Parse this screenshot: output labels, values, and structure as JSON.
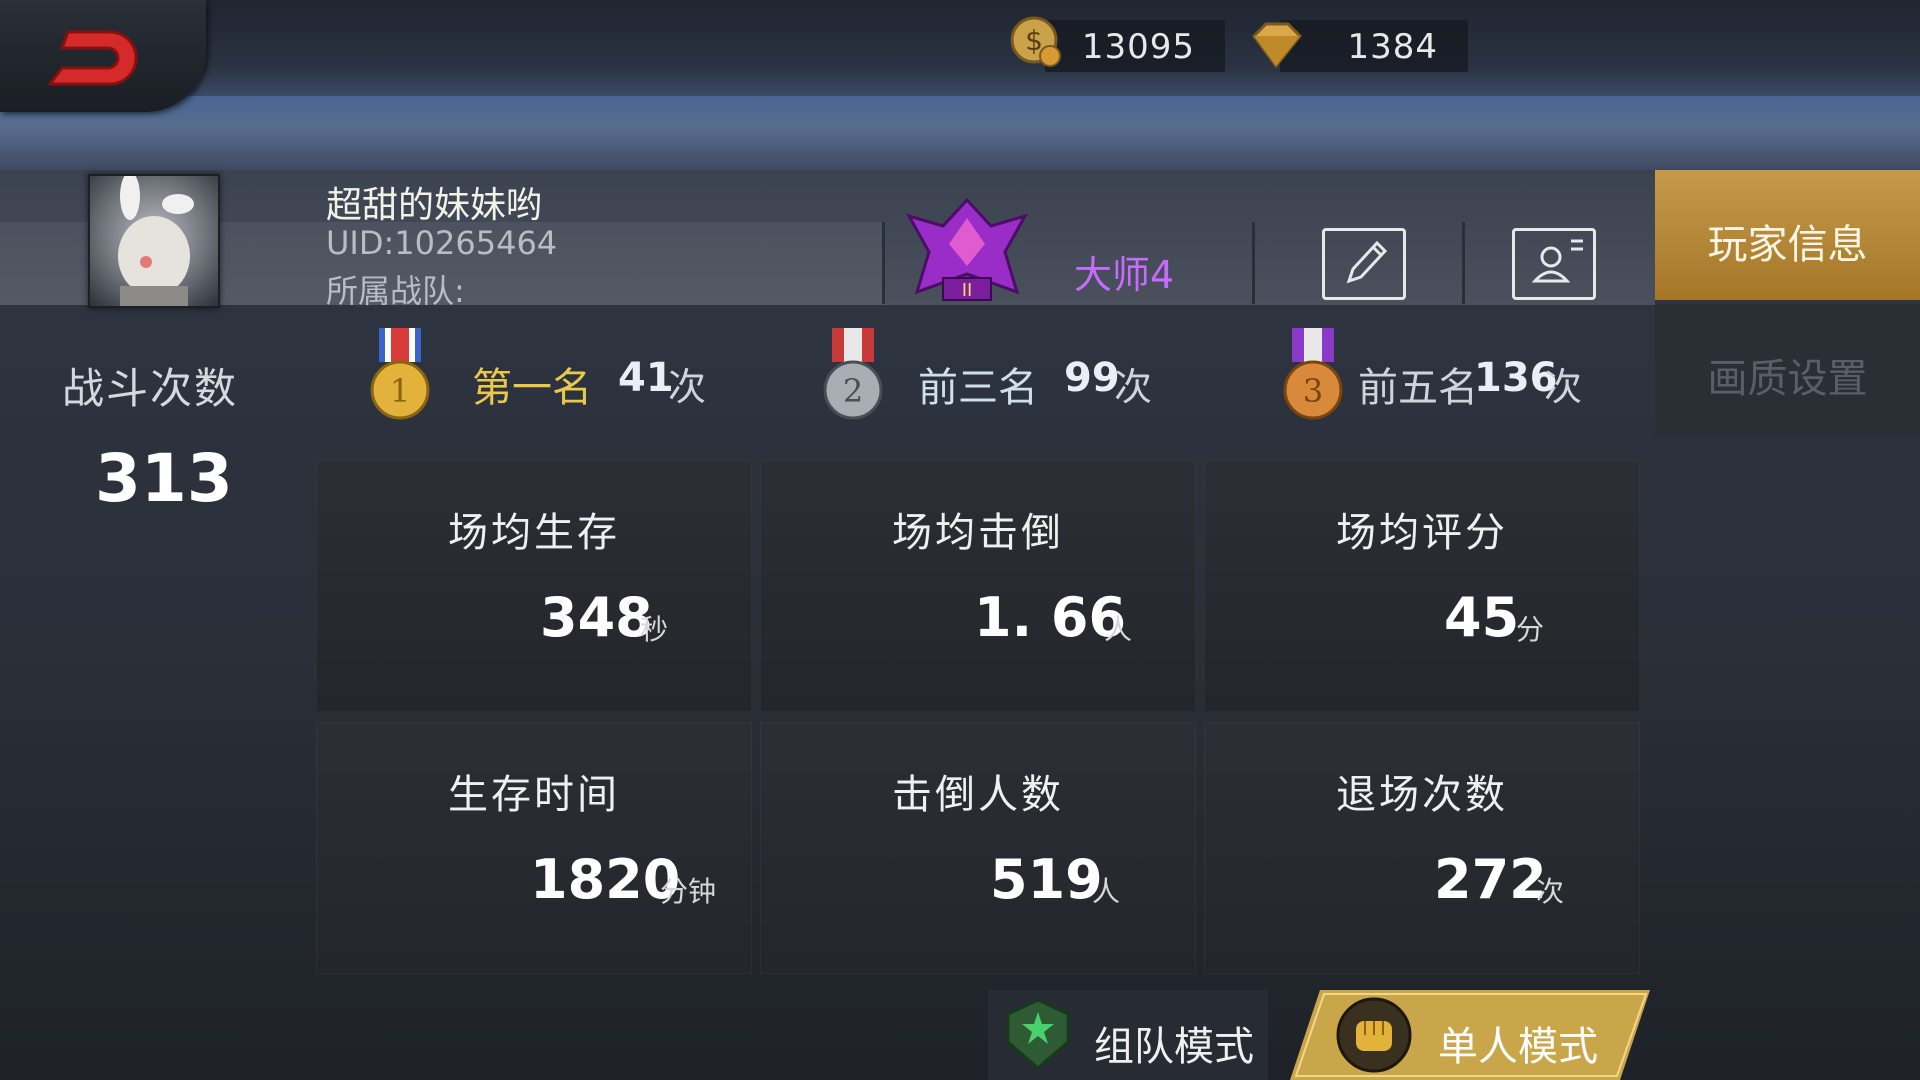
{
  "currency": {
    "coins": "13095",
    "gems": "1384"
  },
  "player": {
    "name": "超甜的妹妹哟",
    "uid": "UID:10265464",
    "team_label": "所属战队:",
    "rank": "大师4"
  },
  "tabs": {
    "player_info": "玩家信息",
    "quality_settings": "画质设置"
  },
  "battles": {
    "label": "战斗次数",
    "count": "313"
  },
  "medals": [
    {
      "label": "第一名",
      "count": "41",
      "unit": "次",
      "color": "#e9c84a"
    },
    {
      "label": "前三名",
      "count": "99",
      "unit": "次",
      "color": "#cfe0ec"
    },
    {
      "label": "前五名",
      "count": "136",
      "unit": "次",
      "color": "#d0d4da"
    }
  ],
  "stats": [
    {
      "title": "场均生存",
      "value": "348",
      "unit": "秒"
    },
    {
      "title": "场均击倒",
      "value": "1. 66",
      "unit": "人"
    },
    {
      "title": "场均评分",
      "value": "45",
      "unit": "分"
    },
    {
      "title": "生存时间",
      "value": "1820",
      "unit": "分钟"
    },
    {
      "title": "击倒人数",
      "value": "519",
      "unit": "人"
    },
    {
      "title": "退场次数",
      "value": "272",
      "unit": "次"
    }
  ],
  "modes": {
    "team": "组队模式",
    "solo": "单人模式"
  },
  "colors": {
    "gold_tab": "#b8873a",
    "rank_purple": "#c76bff",
    "solo_mode": "#c9a64a"
  },
  "icons": [
    "back-arrow-icon",
    "coin-icon",
    "gem-icon",
    "rank-emblem-icon",
    "edit-icon",
    "profile-card-icon",
    "gold-medal-icon",
    "silver-medal-icon",
    "bronze-medal-icon",
    "team-mode-icon",
    "fist-icon"
  ]
}
